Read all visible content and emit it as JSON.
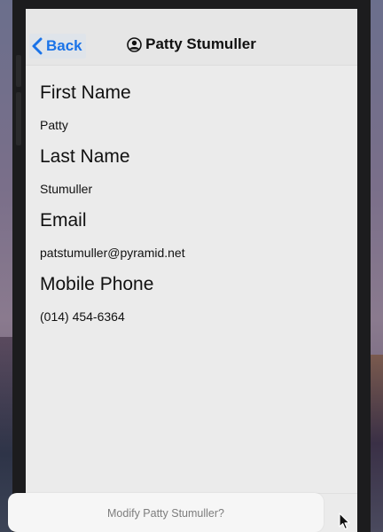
{
  "navbar": {
    "back_label": "Back",
    "title": "Patty Stumuller",
    "back_icon": "chevron-left-icon",
    "title_icon": "person-circle-icon"
  },
  "fields": [
    {
      "label": "First Name",
      "value": "Patty"
    },
    {
      "label": "Last Name",
      "value": "Stumuller"
    },
    {
      "label": "Email",
      "value": "patstumuller@pyramid.net"
    },
    {
      "label": "Mobile Phone",
      "value": "(014) 454-6364"
    }
  ],
  "footer": {
    "modify_label": "Modify Patty Stumuller?"
  },
  "colors": {
    "accent": "#1a73e8",
    "screen_background": "#ebebeb",
    "device_frame": "#1c1c1e"
  }
}
